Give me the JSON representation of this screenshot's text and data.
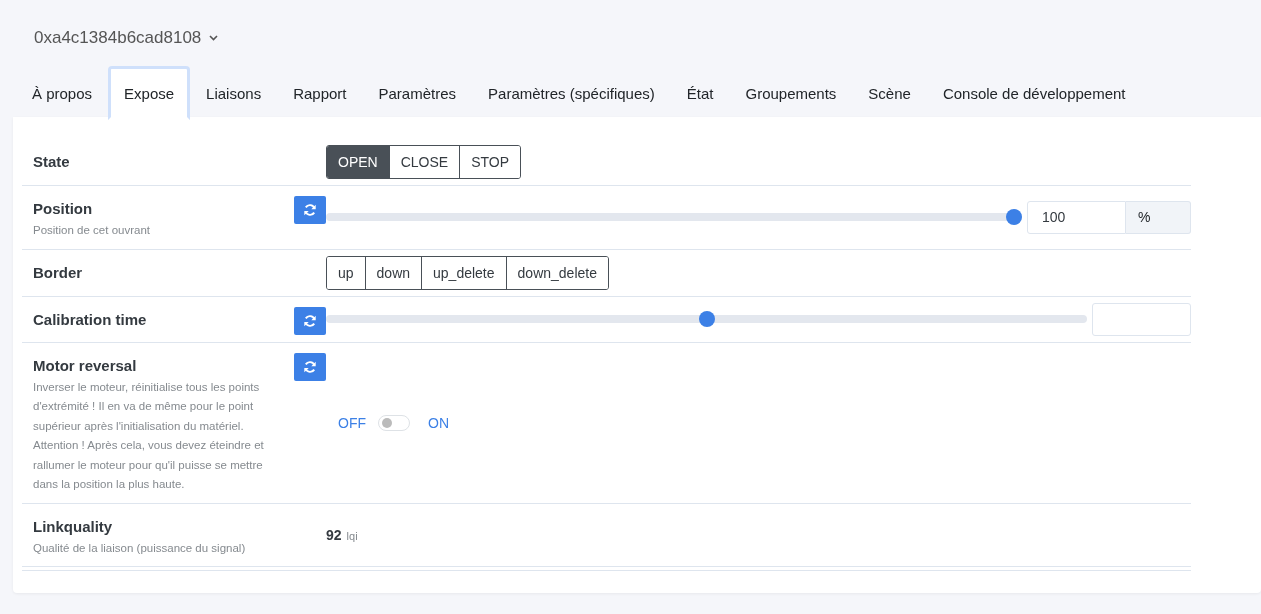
{
  "device": {
    "name": "0xa4c1384b6cad8108"
  },
  "tabs": [
    {
      "label": "À propos",
      "selected": false
    },
    {
      "label": "Expose",
      "selected": true
    },
    {
      "label": "Liaisons",
      "selected": false
    },
    {
      "label": "Rapport",
      "selected": false
    },
    {
      "label": "Paramètres",
      "selected": false
    },
    {
      "label": "Paramètres (spécifiques)",
      "selected": false
    },
    {
      "label": "État",
      "selected": false
    },
    {
      "label": "Groupements",
      "selected": false
    },
    {
      "label": "Scène",
      "selected": false
    },
    {
      "label": "Console de développement",
      "selected": false
    }
  ],
  "features": [
    {
      "kind": "enum",
      "label": "State",
      "refresh": false,
      "options": [
        {
          "label": "OPEN",
          "selected": true
        },
        {
          "label": "CLOSE",
          "selected": false
        },
        {
          "label": "STOP",
          "selected": false
        }
      ]
    },
    {
      "kind": "numeric",
      "label": "Position",
      "description": "Position de cet ouvrant",
      "refresh": true,
      "level": 1,
      "value": "100",
      "unit": "%"
    },
    {
      "kind": "enum",
      "label": "Border",
      "refresh": false,
      "options": [
        {
          "label": "up",
          "selected": false
        },
        {
          "label": "down",
          "selected": false
        },
        {
          "label": "up_delete",
          "selected": false
        },
        {
          "label": "down_delete",
          "selected": false
        }
      ]
    },
    {
      "kind": "numeric",
      "label": "Calibration time",
      "refresh": true,
      "level": 0.5
    },
    {
      "kind": "binary",
      "label": "Motor reversal",
      "description": "Inverser le moteur, réinitialise tous les points d'extrémité ! Il en va de même pour le point supérieur après l'initialisation du matériel. Attention ! Après cela, vous devez éteindre et rallumer le moteur pour qu'il puisse se mettre dans la position la plus haute.",
      "refresh": true,
      "off_label": "OFF",
      "on_label": "ON",
      "on": false
    },
    {
      "kind": "value",
      "label": "Linkquality",
      "description": "Qualité de la liaison (puissance du signal)",
      "refresh": false,
      "value": "92",
      "unit": "lqi"
    }
  ]
}
